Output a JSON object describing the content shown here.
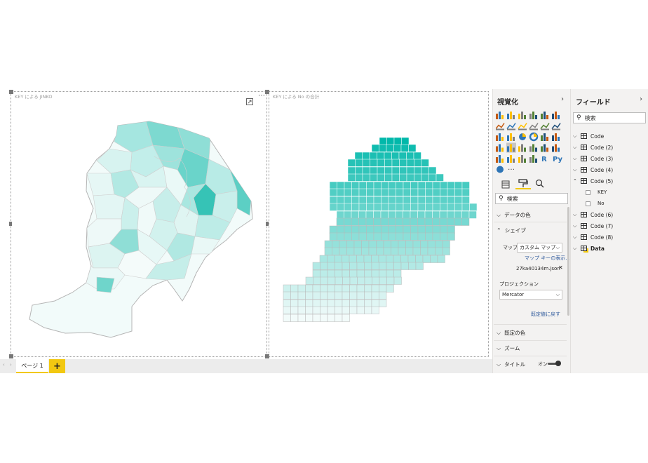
{
  "canvas": {
    "visual1_title": "KEY による JINKO",
    "visual2_title": "KEY による No の合計"
  },
  "pages": {
    "tab_label": "ページ 1",
    "add_label": "+"
  },
  "viz_pane": {
    "title": "視覚化",
    "search_placeholder": "検索",
    "more_label": "…",
    "sections": {
      "data_colors": "データの色",
      "shape": "シェイプ",
      "default_color": "既定の色",
      "zoom": "ズーム",
      "title": "タイトル"
    },
    "map_label": "マップ",
    "map_value": "カスタム マップ",
    "map_keys_link": "マップ キーの表示...",
    "file_name": "27ka40134m.json",
    "projection_label": "プロジェクション",
    "projection_value": "Mercator",
    "reset_link": "既定値に戻す",
    "title_toggle_label": "オン"
  },
  "fields_pane": {
    "title": "フィールド",
    "search_placeholder": "検索",
    "tables": [
      {
        "name": "Code",
        "expanded": false
      },
      {
        "name": "Code (2)",
        "expanded": false
      },
      {
        "name": "Code (3)",
        "expanded": false
      },
      {
        "name": "Code (4)",
        "expanded": false
      },
      {
        "name": "Code (5)",
        "expanded": true,
        "fields": [
          "KEY",
          "No"
        ]
      },
      {
        "name": "Code (6)",
        "expanded": false
      },
      {
        "name": "Code (7)",
        "expanded": false
      },
      {
        "name": "Code (8)",
        "expanded": false
      },
      {
        "name": "Data",
        "expanded": false
      }
    ]
  },
  "colors": {
    "accent": "#f2c811",
    "map_dark": "#01b8aa",
    "map_light": "#f2fbfa"
  }
}
